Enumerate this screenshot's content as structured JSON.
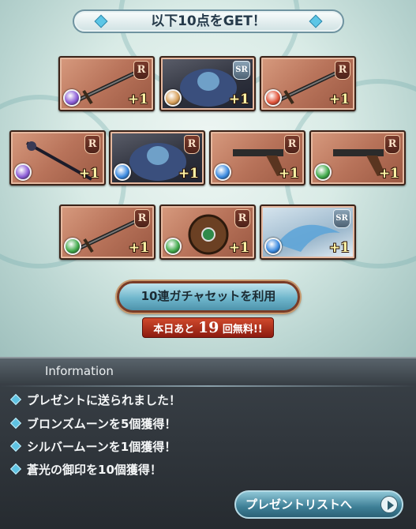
{
  "banner": {
    "title": "以下10点をGET！"
  },
  "cards": [
    {
      "rarity": "R",
      "count": "+1",
      "element": "dark",
      "kind": "sword",
      "element_color": "#8b5cd6"
    },
    {
      "rarity": "SR",
      "count": "+1",
      "element": "light",
      "kind": "character",
      "element_color": "#d8a05a"
    },
    {
      "rarity": "R",
      "count": "+1",
      "element": "fire",
      "kind": "sword",
      "element_color": "#e2543a"
    },
    {
      "rarity": "R",
      "count": "+1",
      "element": "dark",
      "kind": "spear",
      "element_color": "#8b5cd6"
    },
    {
      "rarity": "R",
      "count": "+1",
      "element": "water",
      "kind": "character",
      "element_color": "#3b8ae0"
    },
    {
      "rarity": "R",
      "count": "+1",
      "element": "water",
      "kind": "gun",
      "element_color": "#3b8ae0"
    },
    {
      "rarity": "R",
      "count": "+1",
      "element": "wind",
      "kind": "gun",
      "element_color": "#3fa94a"
    },
    {
      "rarity": "R",
      "count": "+1",
      "element": "wind",
      "kind": "sword",
      "element_color": "#3fa94a"
    },
    {
      "rarity": "R",
      "count": "+1",
      "element": "wind",
      "kind": "shield",
      "element_color": "#3fa94a"
    },
    {
      "rarity": "SR",
      "count": "+1",
      "element": "water",
      "kind": "summon",
      "element_color": "#3b8ae0"
    }
  ],
  "gacha": {
    "ten_draw_label": "10連ガチャセットを利用",
    "free_prefix": "本日あと",
    "free_count": "19",
    "free_suffix": "回無料!!"
  },
  "info": {
    "title": "Information",
    "messages": [
      "プレゼントに送られました！",
      "ブロンズムーンを5個獲得！",
      "シルバームーンを1個獲得！",
      "蒼光の御印を10個獲得！"
    ],
    "present_list_label": "プレゼントリストへ"
  }
}
